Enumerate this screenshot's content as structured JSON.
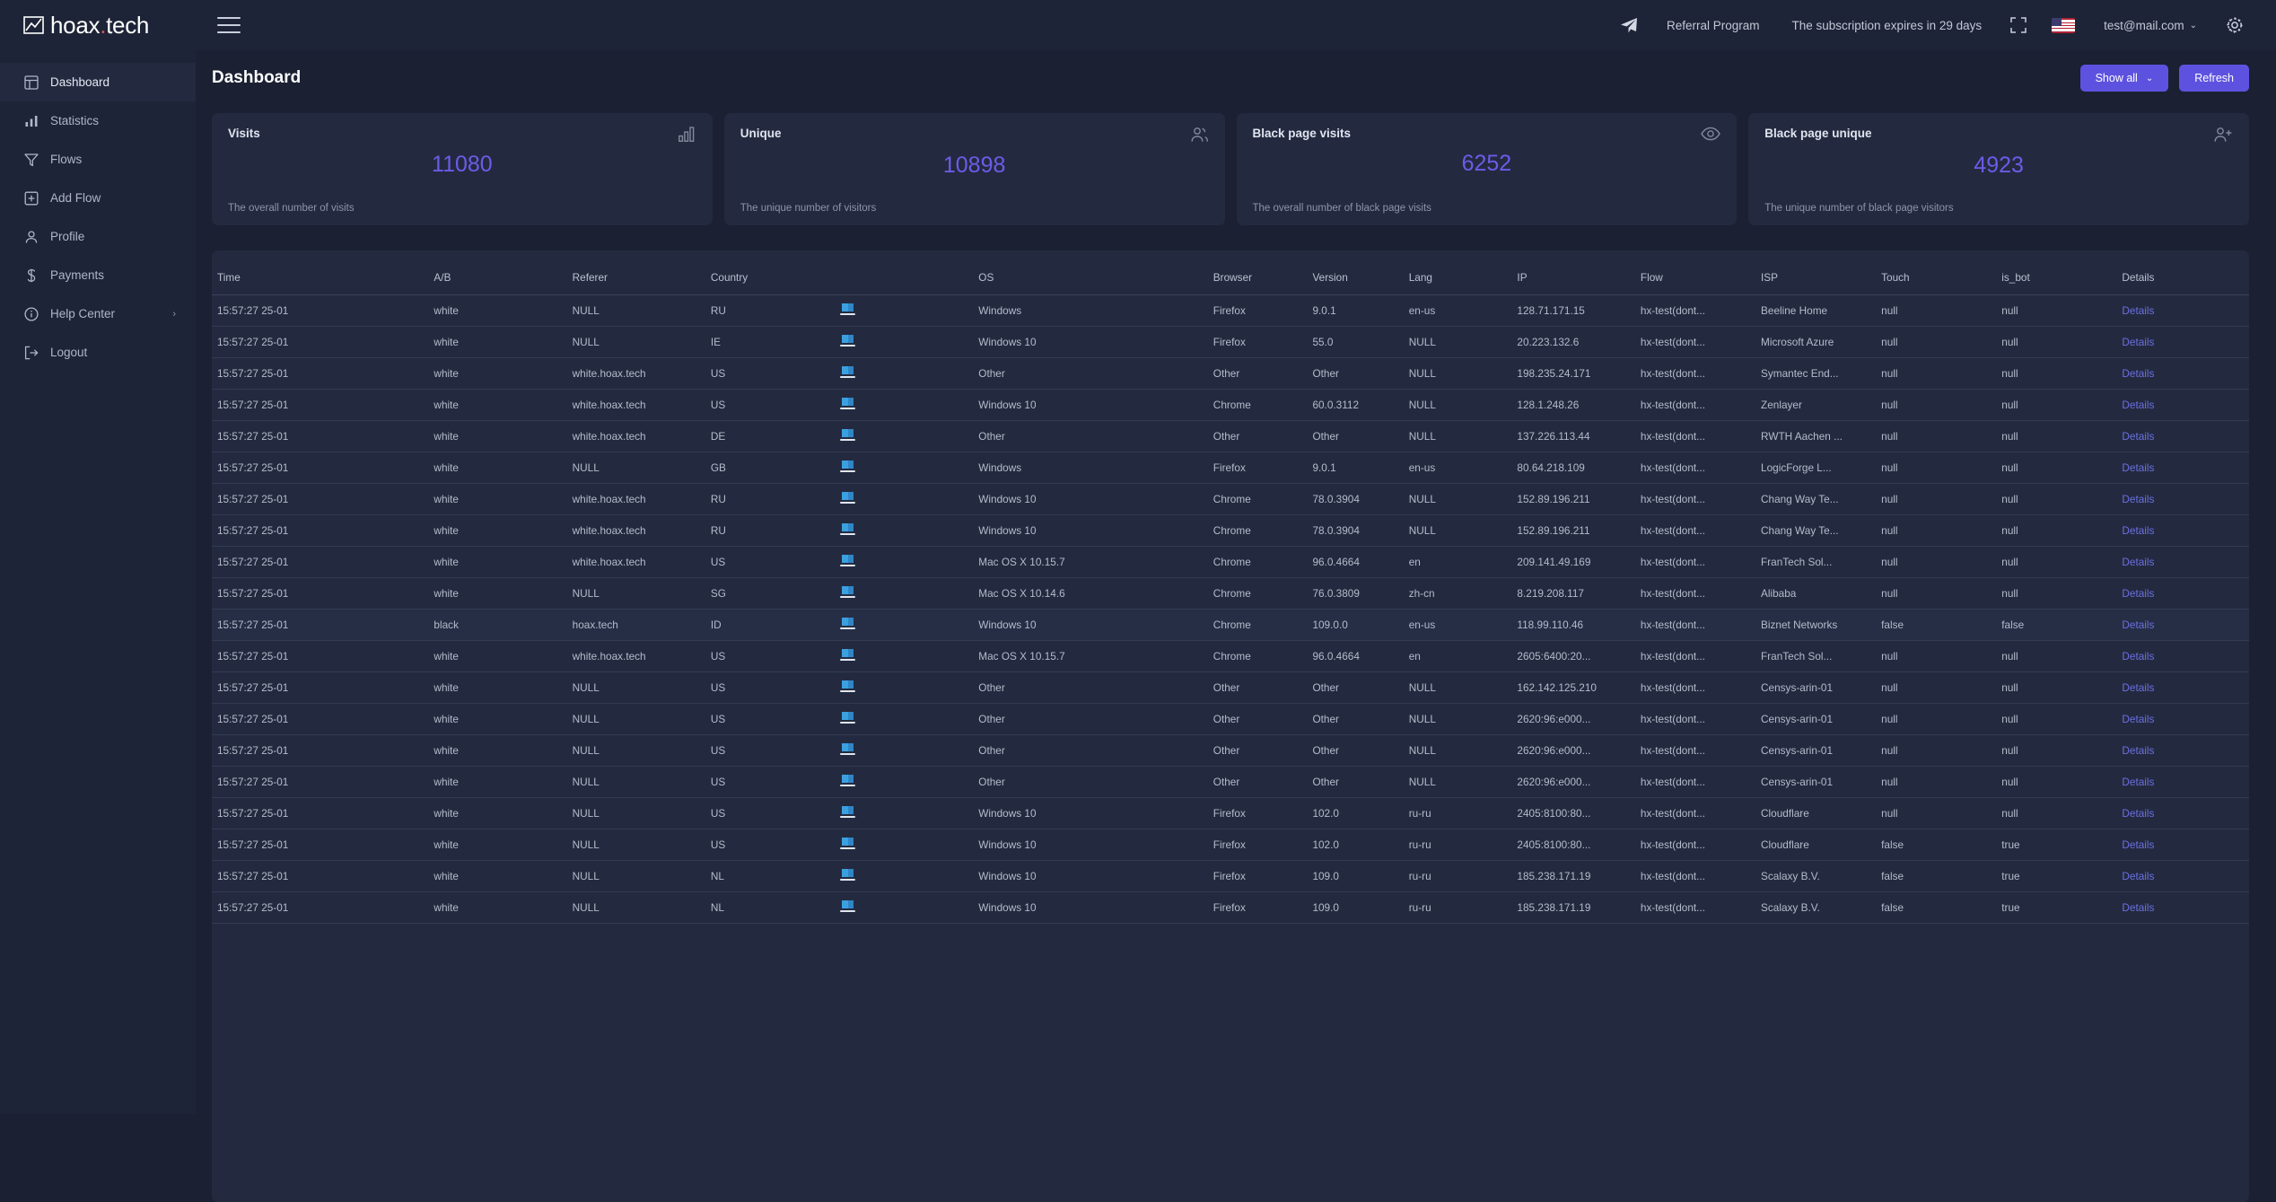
{
  "brand": {
    "name": "hoax",
    "dot": ".",
    "suffix": "tech",
    "logo_icon": "image-chart-logo-icon"
  },
  "topbar": {
    "menu_icon": "hamburger-menu-icon",
    "telegram_icon": "telegram-send-icon",
    "referral_label": "Referral Program",
    "subscription_label": "The subscription expires in 29 days",
    "fullscreen_icon": "fullscreen-icon",
    "flag_icon": "us-flag-icon",
    "user_email": "test@mail.com",
    "user_caret": "⌄",
    "settings_icon": "gear-icon"
  },
  "sidebar": {
    "items": [
      {
        "label": "Dashboard",
        "icon": "layout-dashboard-icon",
        "active": true
      },
      {
        "label": "Statistics",
        "icon": "bar-chart-icon",
        "active": false
      },
      {
        "label": "Flows",
        "icon": "filter-funnel-icon",
        "active": false
      },
      {
        "label": "Add Flow",
        "icon": "plus-square-icon",
        "active": false
      },
      {
        "label": "Profile",
        "icon": "user-icon",
        "active": false
      },
      {
        "label": "Payments",
        "icon": "dollar-icon",
        "active": false
      },
      {
        "label": "Help Center",
        "icon": "info-circle-icon",
        "active": false,
        "chevron": "›"
      },
      {
        "label": "Logout",
        "icon": "logout-icon",
        "active": false
      }
    ]
  },
  "page": {
    "title": "Dashboard",
    "show_all_label": "Show all",
    "show_all_caret": "⌄",
    "refresh_label": "Refresh",
    "accent_color": "#5d52e0",
    "value_color": "#6c5ce7"
  },
  "cards": [
    {
      "title": "Visits",
      "value": "11080",
      "desc": "The overall number of visits",
      "icon": "bar-chart-icon"
    },
    {
      "title": "Unique",
      "value": "10898",
      "desc": "The unique number of visitors",
      "icon": "users-icon"
    },
    {
      "title": "Black page visits",
      "value": "6252",
      "desc": "The overall number of black page visits",
      "icon": "eye-icon"
    },
    {
      "title": "Black page unique",
      "value": "4923",
      "desc": "The unique number of black page visitors",
      "icon": "user-plus-icon"
    }
  ],
  "table": {
    "columns": [
      "Time",
      "A/B",
      "Referer",
      "Country",
      "",
      "OS",
      "Browser",
      "Version",
      "Lang",
      "IP",
      "Flow",
      "ISP",
      "Touch",
      "is_bot",
      "Details"
    ],
    "device_icon": "laptop-icon",
    "details_label": "Details",
    "rows": [
      {
        "time": "15:57:27 25-01",
        "ab": "white",
        "referer": "NULL",
        "country": "RU",
        "os": "Windows",
        "browser": "Firefox",
        "version": "9.0.1",
        "lang": "en-us",
        "ip": "128.71.171.15",
        "flow": "hx-test(dont...",
        "isp": "Beeline Home",
        "touch": "null",
        "is_bot": "null",
        "highlight": false
      },
      {
        "time": "15:57:27 25-01",
        "ab": "white",
        "referer": "NULL",
        "country": "IE",
        "os": "Windows 10",
        "browser": "Firefox",
        "version": "55.0",
        "lang": "NULL",
        "ip": "20.223.132.6",
        "flow": "hx-test(dont...",
        "isp": "Microsoft Azure",
        "touch": "null",
        "is_bot": "null",
        "highlight": false
      },
      {
        "time": "15:57:27 25-01",
        "ab": "white",
        "referer": "white.hoax.tech",
        "country": "US",
        "os": "Other",
        "browser": "Other",
        "version": "Other",
        "lang": "NULL",
        "ip": "198.235.24.171",
        "flow": "hx-test(dont...",
        "isp": "Symantec End...",
        "touch": "null",
        "is_bot": "null",
        "highlight": false
      },
      {
        "time": "15:57:27 25-01",
        "ab": "white",
        "referer": "white.hoax.tech",
        "country": "US",
        "os": "Windows 10",
        "browser": "Chrome",
        "version": "60.0.3112",
        "lang": "NULL",
        "ip": "128.1.248.26",
        "flow": "hx-test(dont...",
        "isp": "Zenlayer",
        "touch": "null",
        "is_bot": "null",
        "highlight": false
      },
      {
        "time": "15:57:27 25-01",
        "ab": "white",
        "referer": "white.hoax.tech",
        "country": "DE",
        "os": "Other",
        "browser": "Other",
        "version": "Other",
        "lang": "NULL",
        "ip": "137.226.113.44",
        "flow": "hx-test(dont...",
        "isp": "RWTH Aachen ...",
        "touch": "null",
        "is_bot": "null",
        "highlight": false
      },
      {
        "time": "15:57:27 25-01",
        "ab": "white",
        "referer": "NULL",
        "country": "GB",
        "os": "Windows",
        "browser": "Firefox",
        "version": "9.0.1",
        "lang": "en-us",
        "ip": "80.64.218.109",
        "flow": "hx-test(dont...",
        "isp": "LogicForge L...",
        "touch": "null",
        "is_bot": "null",
        "highlight": false
      },
      {
        "time": "15:57:27 25-01",
        "ab": "white",
        "referer": "white.hoax.tech",
        "country": "RU",
        "os": "Windows 10",
        "browser": "Chrome",
        "version": "78.0.3904",
        "lang": "NULL",
        "ip": "152.89.196.211",
        "flow": "hx-test(dont...",
        "isp": "Chang Way Te...",
        "touch": "null",
        "is_bot": "null",
        "highlight": false
      },
      {
        "time": "15:57:27 25-01",
        "ab": "white",
        "referer": "white.hoax.tech",
        "country": "RU",
        "os": "Windows 10",
        "browser": "Chrome",
        "version": "78.0.3904",
        "lang": "NULL",
        "ip": "152.89.196.211",
        "flow": "hx-test(dont...",
        "isp": "Chang Way Te...",
        "touch": "null",
        "is_bot": "null",
        "highlight": false
      },
      {
        "time": "15:57:27 25-01",
        "ab": "white",
        "referer": "white.hoax.tech",
        "country": "US",
        "os": "Mac OS X 10.15.7",
        "browser": "Chrome",
        "version": "96.0.4664",
        "lang": "en",
        "ip": "209.141.49.169",
        "flow": "hx-test(dont...",
        "isp": "FranTech Sol...",
        "touch": "null",
        "is_bot": "null",
        "highlight": false
      },
      {
        "time": "15:57:27 25-01",
        "ab": "white",
        "referer": "NULL",
        "country": "SG",
        "os": "Mac OS X 10.14.6",
        "browser": "Chrome",
        "version": "76.0.3809",
        "lang": "zh-cn",
        "ip": "8.219.208.117",
        "flow": "hx-test(dont...",
        "isp": "Alibaba",
        "touch": "null",
        "is_bot": "null",
        "highlight": false
      },
      {
        "time": "15:57:27 25-01",
        "ab": "black",
        "referer": "hoax.tech",
        "country": "ID",
        "os": "Windows 10",
        "browser": "Chrome",
        "version": "109.0.0",
        "lang": "en-us",
        "ip": "118.99.110.46",
        "flow": "hx-test(dont...",
        "isp": "Biznet Networks",
        "touch": "false",
        "is_bot": "false",
        "highlight": true
      },
      {
        "time": "15:57:27 25-01",
        "ab": "white",
        "referer": "white.hoax.tech",
        "country": "US",
        "os": "Mac OS X 10.15.7",
        "browser": "Chrome",
        "version": "96.0.4664",
        "lang": "en",
        "ip": "2605:6400:20...",
        "flow": "hx-test(dont...",
        "isp": "FranTech Sol...",
        "touch": "null",
        "is_bot": "null",
        "highlight": false
      },
      {
        "time": "15:57:27 25-01",
        "ab": "white",
        "referer": "NULL",
        "country": "US",
        "os": "Other",
        "browser": "Other",
        "version": "Other",
        "lang": "NULL",
        "ip": "162.142.125.210",
        "flow": "hx-test(dont...",
        "isp": "Censys-arin-01",
        "touch": "null",
        "is_bot": "null",
        "highlight": false
      },
      {
        "time": "15:57:27 25-01",
        "ab": "white",
        "referer": "NULL",
        "country": "US",
        "os": "Other",
        "browser": "Other",
        "version": "Other",
        "lang": "NULL",
        "ip": "2620:96:e000...",
        "flow": "hx-test(dont...",
        "isp": "Censys-arin-01",
        "touch": "null",
        "is_bot": "null",
        "highlight": false
      },
      {
        "time": "15:57:27 25-01",
        "ab": "white",
        "referer": "NULL",
        "country": "US",
        "os": "Other",
        "browser": "Other",
        "version": "Other",
        "lang": "NULL",
        "ip": "2620:96:e000...",
        "flow": "hx-test(dont...",
        "isp": "Censys-arin-01",
        "touch": "null",
        "is_bot": "null",
        "highlight": false
      },
      {
        "time": "15:57:27 25-01",
        "ab": "white",
        "referer": "NULL",
        "country": "US",
        "os": "Other",
        "browser": "Other",
        "version": "Other",
        "lang": "NULL",
        "ip": "2620:96:e000...",
        "flow": "hx-test(dont...",
        "isp": "Censys-arin-01",
        "touch": "null",
        "is_bot": "null",
        "highlight": false
      },
      {
        "time": "15:57:27 25-01",
        "ab": "white",
        "referer": "NULL",
        "country": "US",
        "os": "Windows 10",
        "browser": "Firefox",
        "version": "102.0",
        "lang": "ru-ru",
        "ip": "2405:8100:80...",
        "flow": "hx-test(dont...",
        "isp": "Cloudflare",
        "touch": "null",
        "is_bot": "null",
        "highlight": false
      },
      {
        "time": "15:57:27 25-01",
        "ab": "white",
        "referer": "NULL",
        "country": "US",
        "os": "Windows 10",
        "browser": "Firefox",
        "version": "102.0",
        "lang": "ru-ru",
        "ip": "2405:8100:80...",
        "flow": "hx-test(dont...",
        "isp": "Cloudflare",
        "touch": "false",
        "is_bot": "true",
        "highlight": false
      },
      {
        "time": "15:57:27 25-01",
        "ab": "white",
        "referer": "NULL",
        "country": "NL",
        "os": "Windows 10",
        "browser": "Firefox",
        "version": "109.0",
        "lang": "ru-ru",
        "ip": "185.238.171.19",
        "flow": "hx-test(dont...",
        "isp": "Scalaxy B.V.",
        "touch": "false",
        "is_bot": "true",
        "highlight": false
      },
      {
        "time": "15:57:27 25-01",
        "ab": "white",
        "referer": "NULL",
        "country": "NL",
        "os": "Windows 10",
        "browser": "Firefox",
        "version": "109.0",
        "lang": "ru-ru",
        "ip": "185.238.171.19",
        "flow": "hx-test(dont...",
        "isp": "Scalaxy B.V.",
        "touch": "false",
        "is_bot": "true",
        "highlight": false
      }
    ]
  }
}
